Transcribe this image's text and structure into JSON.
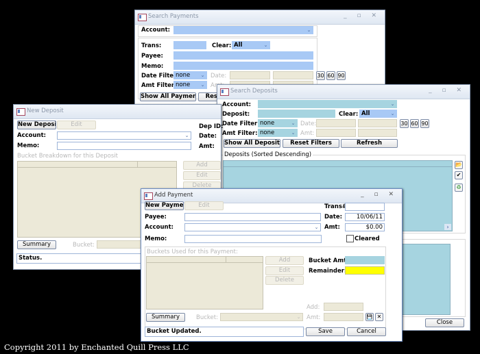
{
  "search_payments": {
    "title": "Search Payments",
    "controls": "_ ▫ ✕",
    "account_label": "Account:",
    "trans_label": "Trans:",
    "clear_label": "Clear:",
    "clear_value": "All",
    "payee_label": "Payee:",
    "memo_label": "Memo:",
    "date_filter_label": "Date Filter:",
    "date_filter_value": "none",
    "date_label": "Date:",
    "amt_filter_label": "Amt Filter:",
    "amt_filter_value": "none",
    "amt_label": "Amt:",
    "btn_30": "30",
    "btn_60": "60",
    "btn_90": "90",
    "show_all_button": "Show All Payments",
    "reset_button": "Reset Filters"
  },
  "search_deposits": {
    "title": "Search Deposits",
    "controls": "_ ▫ ✕",
    "account_label": "Account:",
    "deposit_label": "Deposit:",
    "clear_label": "Clear:",
    "clear_value": "All",
    "date_filter_label": "Date Filter:",
    "date_filter_value": "none",
    "date_label": "Date:",
    "amt_filter_label": "Amt Filter:",
    "amt_filter_value": "none",
    "amt_label": "Amt:",
    "btn_30": "30",
    "btn_60": "60",
    "btn_90": "90",
    "show_all_button": "Show All Deposits",
    "reset_button": "Reset Filters",
    "refresh_button": "Refresh",
    "list_label": "Deposits (Sorted Descending)",
    "close_button": "Close"
  },
  "new_deposit": {
    "title": "New Deposit",
    "new_button": "New Deposit",
    "edit_button": "Edit",
    "account_label": "Account:",
    "memo_label": "Memo:",
    "dep_id_label": "Dep ID:",
    "date_label": "Date:",
    "amt_label": "Amt:",
    "breakdown_label": "Bucket Breakdown for this Deposit",
    "add_button": "Add",
    "edit2_button": "Edit",
    "delete_button": "Delete",
    "summary_button": "Summary",
    "bucket_label": "Bucket:",
    "status_text": "Status."
  },
  "add_payment": {
    "title": "Add Payment",
    "controls": "_ ▫ ✕",
    "new_button": "New Payment",
    "edit_button": "Edit",
    "trans_label": "Trans#:",
    "payee_label": "Payee:",
    "date_label": "Date:",
    "date_value": "10/06/11",
    "account_label": "Account:",
    "amt_label": "Amt:",
    "amt_value": "$0.00",
    "memo_label": "Memo:",
    "cleared_label": "Cleared",
    "cleared_checked": false,
    "buckets_label": "Buckets Used for this Payment:",
    "add_button": "Add",
    "edit2_button": "Edit",
    "delete_button": "Delete",
    "bucket_amt_label": "Bucket Amt:",
    "remainder_label": "Remainder:",
    "add_label": "Add:",
    "amt2_label": "Amt:",
    "summary_button": "Summary",
    "bucket_label": "Bucket:",
    "save_icon": "💾",
    "cancel_icon": "✕",
    "status_text": "Bucket Updated.",
    "save_button": "Save",
    "cancel_button": "Cancel"
  },
  "icons": {
    "open": "📂",
    "check": "✔",
    "recycle": "♻",
    "scroll_right": "›",
    "dropdown": "⌄"
  },
  "copyright": "Copyright 2011 by Enchanted Quill Press LLC"
}
